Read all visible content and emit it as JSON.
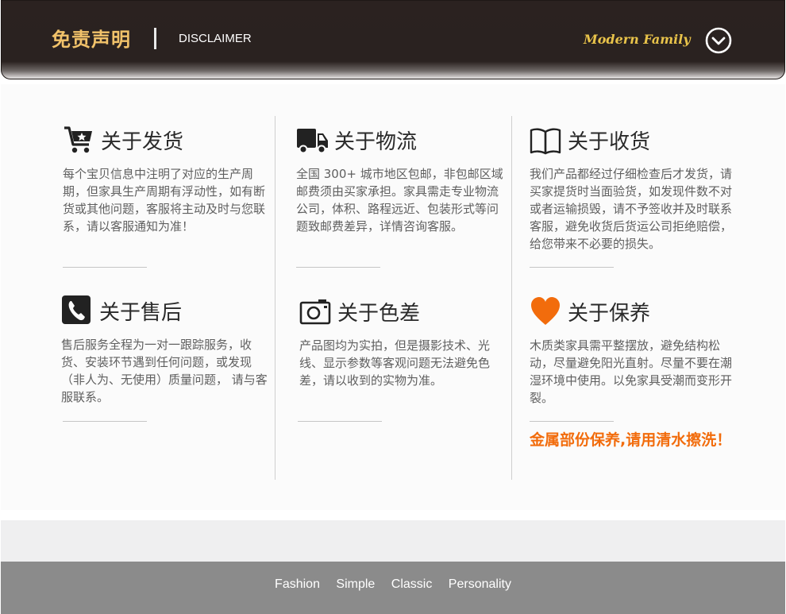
{
  "header": {
    "title": "免责声明",
    "subtitle": "DISCLAIMER",
    "brand": "Modern Family"
  },
  "sections": [
    {
      "title": "关于发货",
      "icon": "cart-icon",
      "body": "每个宝贝信息中注明了对应的生产周期，但家具生产周期有浮动性，如有断货或其他问题，客服将主动及时与您联系，请以客服通知为准！"
    },
    {
      "title": "关于物流",
      "icon": "truck-icon",
      "body": "全国 300+ 城市地区包邮，非包邮区域邮费须由买家承担。家具需走专业物流公司，体积、路程远近、包装形式等问题致邮费差异，详情咨询客服。"
    },
    {
      "title": "关于收货",
      "icon": "open-book-icon",
      "body": "我们产品都经过仔细检查后才发货，请买家提货时当面验货，如发现件数不对或者运输损毁，请不予签收并及时联系客服，避免收货后货运公司拒绝赔偿，给您带来不必要的损失。"
    },
    {
      "title": "关于售后",
      "icon": "phone-icon",
      "body": "售后服务全程为一对一跟踪服务，收货、安装环节遇到任何问题，或发现（非人为、无使用）质量问题， 请与客服联系。"
    },
    {
      "title": "关于色差",
      "icon": "camera-icon",
      "body": "产品图均为实拍，但是摄影技术、光线、显示参数等客观问题无法避免色差，请以收到的实物为准。"
    },
    {
      "title": "关于保养",
      "icon": "heart-icon",
      "body": "木质类家具需平整摆放，避免结构松动，尽量避免阳光直射。尽量不要在潮湿环境中使用。以免家具受潮而变形开裂。"
    }
  ],
  "warning": "金属部份保养,请用清水擦洗！",
  "footer": {
    "links": [
      "Fashion",
      "Simple",
      "Classic",
      "Personality"
    ]
  },
  "colors": {
    "header_bg": "#2b2220",
    "header_title": "#f1c26a",
    "brand": "#e8c34a",
    "accent_orange": "#f26c0c",
    "footer_bg": "#8b8b8b"
  }
}
